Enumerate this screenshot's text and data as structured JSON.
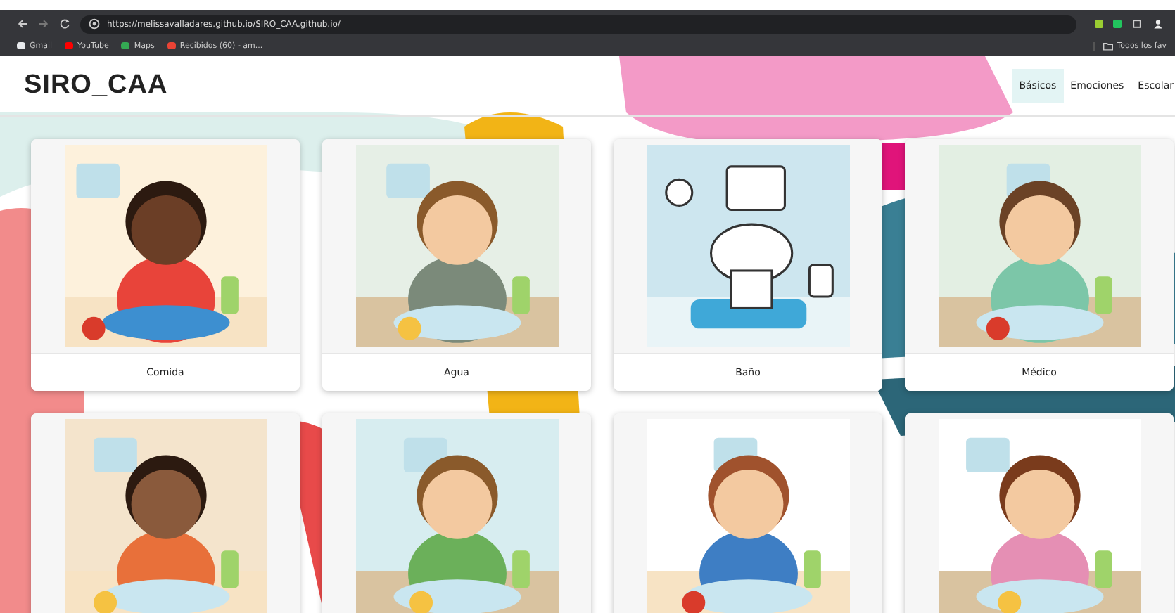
{
  "browser": {
    "url": "https://melissavalladares.github.io/SIRO_CAA.github.io/",
    "bookmarks": [
      {
        "label": "Gmail",
        "color": "#e8eaed"
      },
      {
        "label": "YouTube",
        "color": "#ff0000"
      },
      {
        "label": "Maps",
        "color": "#34a853"
      },
      {
        "label": "Recibidos (60) - am...",
        "color": "#ea4335"
      }
    ],
    "all_bookmarks": "Todos los fav"
  },
  "app": {
    "title": "SIRO_CAA",
    "tabs": [
      {
        "label": "Básicos",
        "selected": true
      },
      {
        "label": "Emociones",
        "selected": false
      },
      {
        "label": "Escolar",
        "selected": false
      }
    ],
    "cards": [
      {
        "kind": "labeled",
        "label": "Comida"
      },
      {
        "kind": "labeled",
        "label": "Agua"
      },
      {
        "kind": "labeled",
        "label": "Baño"
      },
      {
        "kind": "labeled",
        "label": "Médico"
      },
      {
        "kind": "picture"
      },
      {
        "kind": "picture"
      },
      {
        "kind": "picture"
      },
      {
        "kind": "picture"
      }
    ]
  }
}
